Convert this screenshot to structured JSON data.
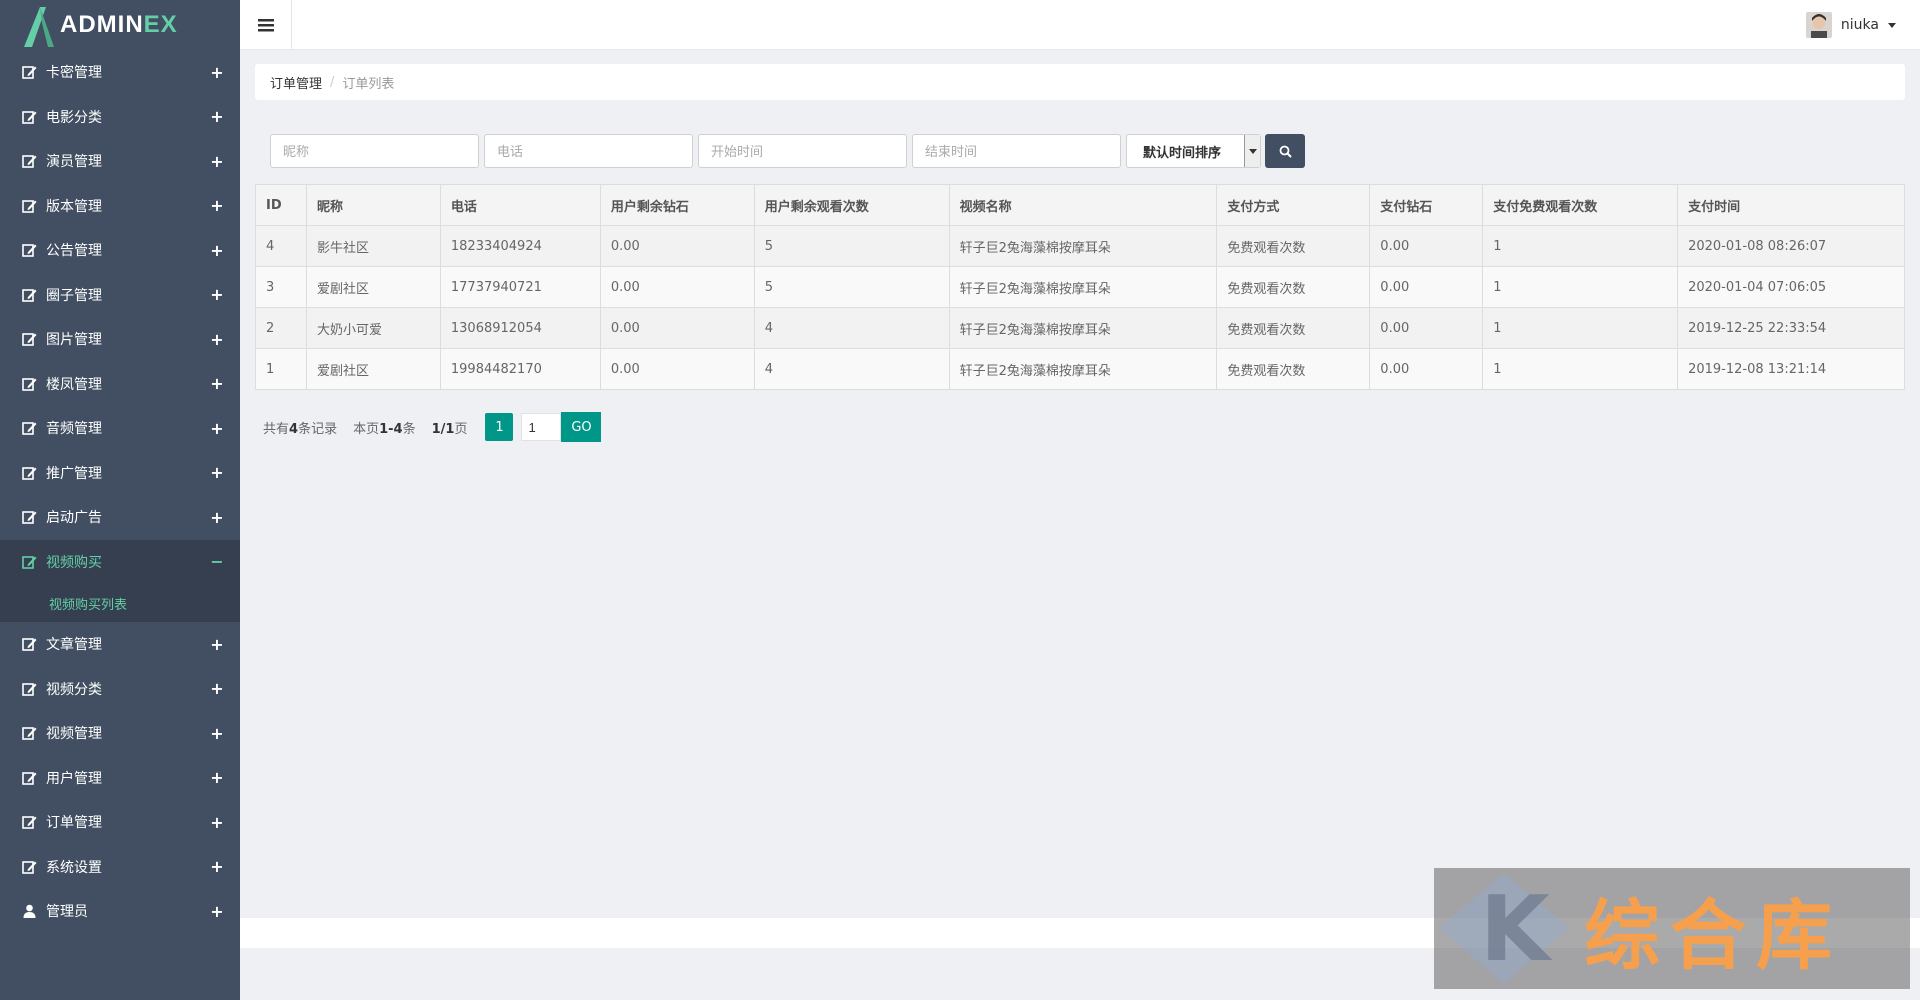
{
  "app": {
    "logo_main": "ADMIN",
    "logo_accent": "EX"
  },
  "user": {
    "name": "niuka"
  },
  "sidebar": {
    "items": [
      {
        "label": "卡密管理",
        "toggle": "+",
        "icon": "edit-icon"
      },
      {
        "label": "电影分类",
        "toggle": "+",
        "icon": "edit-icon"
      },
      {
        "label": "演员管理",
        "toggle": "+",
        "icon": "edit-icon"
      },
      {
        "label": "版本管理",
        "toggle": "+",
        "icon": "edit-icon"
      },
      {
        "label": "公告管理",
        "toggle": "+",
        "icon": "edit-icon"
      },
      {
        "label": "圈子管理",
        "toggle": "+",
        "icon": "edit-icon"
      },
      {
        "label": "图片管理",
        "toggle": "+",
        "icon": "edit-icon"
      },
      {
        "label": "楼凤管理",
        "toggle": "+",
        "icon": "edit-icon"
      },
      {
        "label": "音频管理",
        "toggle": "+",
        "icon": "edit-icon"
      },
      {
        "label": "推广管理",
        "toggle": "+",
        "icon": "edit-icon"
      },
      {
        "label": "启动广告",
        "toggle": "+",
        "icon": "edit-icon"
      },
      {
        "label": "视频购买",
        "toggle": "−",
        "icon": "edit-icon",
        "active": true
      }
    ],
    "submenu_label": "视频购买列表",
    "items_after": [
      {
        "label": "文章管理",
        "toggle": "+",
        "icon": "edit-icon"
      },
      {
        "label": "视频分类",
        "toggle": "+",
        "icon": "edit-icon"
      },
      {
        "label": "视频管理",
        "toggle": "+",
        "icon": "edit-icon"
      },
      {
        "label": "用户管理",
        "toggle": "+",
        "icon": "edit-icon"
      },
      {
        "label": "订单管理",
        "toggle": "+",
        "icon": "edit-icon"
      },
      {
        "label": "系统设置",
        "toggle": "+",
        "icon": "edit-icon"
      },
      {
        "label": "管理员",
        "toggle": "+",
        "icon": "user-icon"
      }
    ]
  },
  "breadcrumb": {
    "parent": "订单管理",
    "separator": "/",
    "current": "订单列表"
  },
  "search": {
    "nickname_placeholder": "昵称",
    "phone_placeholder": "电话",
    "start_placeholder": "开始时间",
    "end_placeholder": "结束时间",
    "sort_selected": "默认时间排序"
  },
  "table": {
    "headers": [
      "ID",
      "昵称",
      "电话",
      "用户剩余钻石",
      "用户剩余观看次数",
      "视频名称",
      "支付方式",
      "支付钻石",
      "支付免费观看次数",
      "支付时间"
    ],
    "rows": [
      [
        "4",
        "影牛社区",
        "18233404924",
        "0.00",
        "5",
        "轩子巨2兔海藻棉按摩耳朵",
        "免费观看次数",
        "0.00",
        "1",
        "2020-01-08 08:26:07"
      ],
      [
        "3",
        "爱剧社区",
        "17737940721",
        "0.00",
        "5",
        "轩子巨2兔海藻棉按摩耳朵",
        "免费观看次数",
        "0.00",
        "1",
        "2020-01-04 07:06:05"
      ],
      [
        "2",
        "大奶小可爱",
        "13068912054",
        "0.00",
        "4",
        "轩子巨2兔海藻棉按摩耳朵",
        "免费观看次数",
        "0.00",
        "1",
        "2019-12-25 22:33:54"
      ],
      [
        "1",
        "爱剧社区",
        "19984482170",
        "0.00",
        "4",
        "轩子巨2兔海藻棉按摩耳朵",
        "免费观看次数",
        "0.00",
        "1",
        "2019-12-08 13:21:14"
      ]
    ]
  },
  "pager": {
    "total_prefix": "共有",
    "total": "4",
    "total_suffix": "条记录",
    "range_prefix": "本页",
    "range": "1-4",
    "range_suffix": "条",
    "pages": "1/1",
    "pages_suffix": "页",
    "current_page": "1",
    "goto_value": "1",
    "go_label": "GO"
  },
  "watermark": {
    "text": "综合库",
    "letter": "K"
  },
  "colors": {
    "sidebar": "#424f63",
    "accent": "#65cea7",
    "pager": "#009688"
  }
}
